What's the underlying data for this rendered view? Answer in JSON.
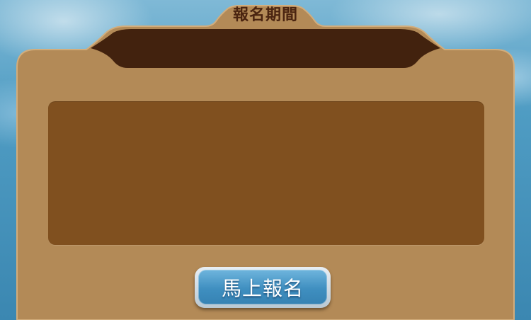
{
  "panel": {
    "title": "報名期間",
    "header_text": "",
    "content_text": ""
  },
  "register_button": {
    "label": "馬上報名"
  },
  "colors": {
    "panel_tan": "#b38a57",
    "header_dark": "#42220e",
    "content_brown": "#80501f",
    "title_text": "#4a2410",
    "button_blue": "#3f8fc0"
  }
}
